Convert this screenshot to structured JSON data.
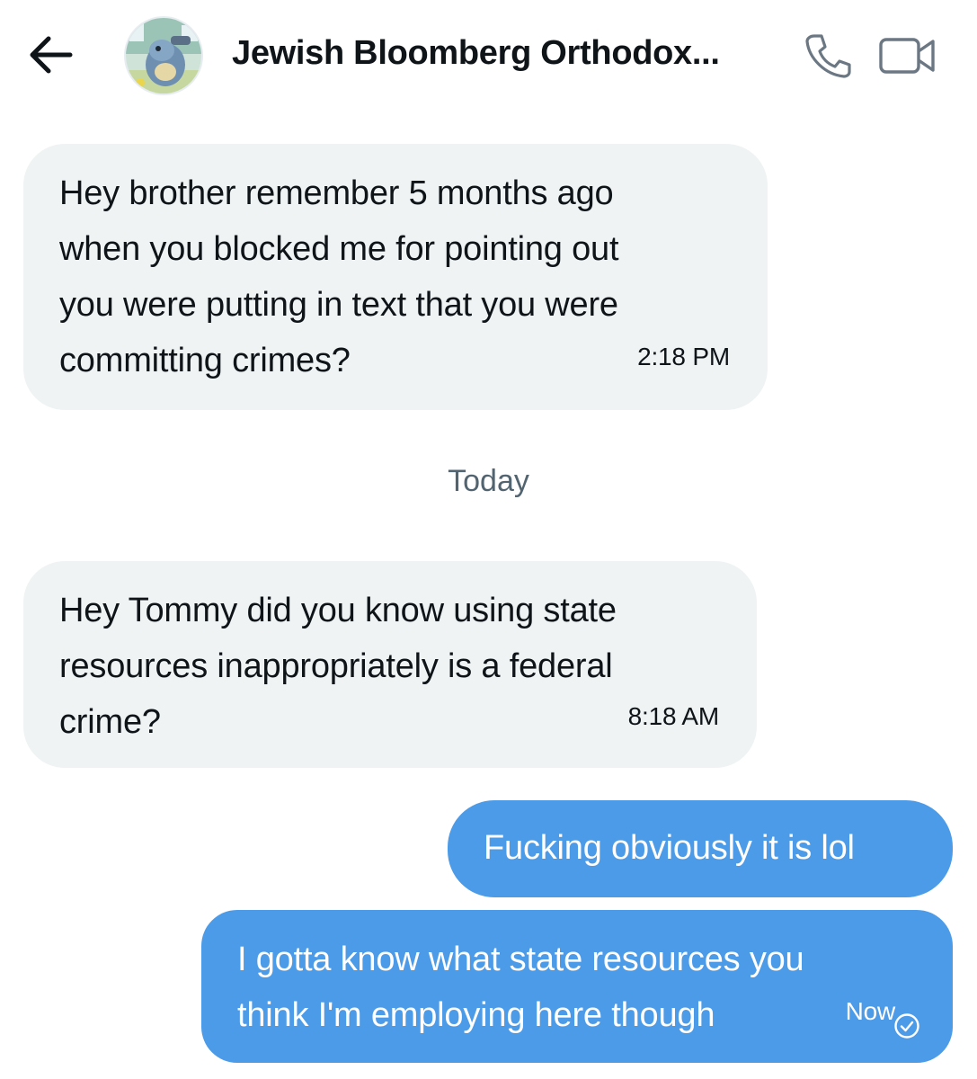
{
  "header": {
    "back_icon": "arrow-left-icon",
    "title": "Jewish Bloomberg Orthodox...",
    "call_icon": "phone-icon",
    "video_icon": "video-camera-icon"
  },
  "messages": [
    {
      "direction": "received",
      "lines": [
        "Hey brother remember 5 months ago",
        "when you blocked me for pointing out",
        "you were putting in text that you were",
        "committing crimes?"
      ],
      "time": "2:18 PM"
    },
    {
      "direction": "received",
      "lines": [
        "Hey Tommy did you know using state",
        "resources inappropriately is a federal",
        "crime?"
      ],
      "time": "8:18 AM"
    },
    {
      "direction": "sent",
      "lines": [
        "Fucking obviously it is lol"
      ]
    },
    {
      "direction": "sent",
      "lines": [
        "I gotta know what state resources you",
        "think I'm employing here though"
      ],
      "time": "Now",
      "status_icon": "read-check-icon"
    }
  ],
  "divider": "Today",
  "colors": {
    "received_bubble": "#eff3f4",
    "sent_bubble": "#4c9be8",
    "divider_text": "#536471"
  }
}
